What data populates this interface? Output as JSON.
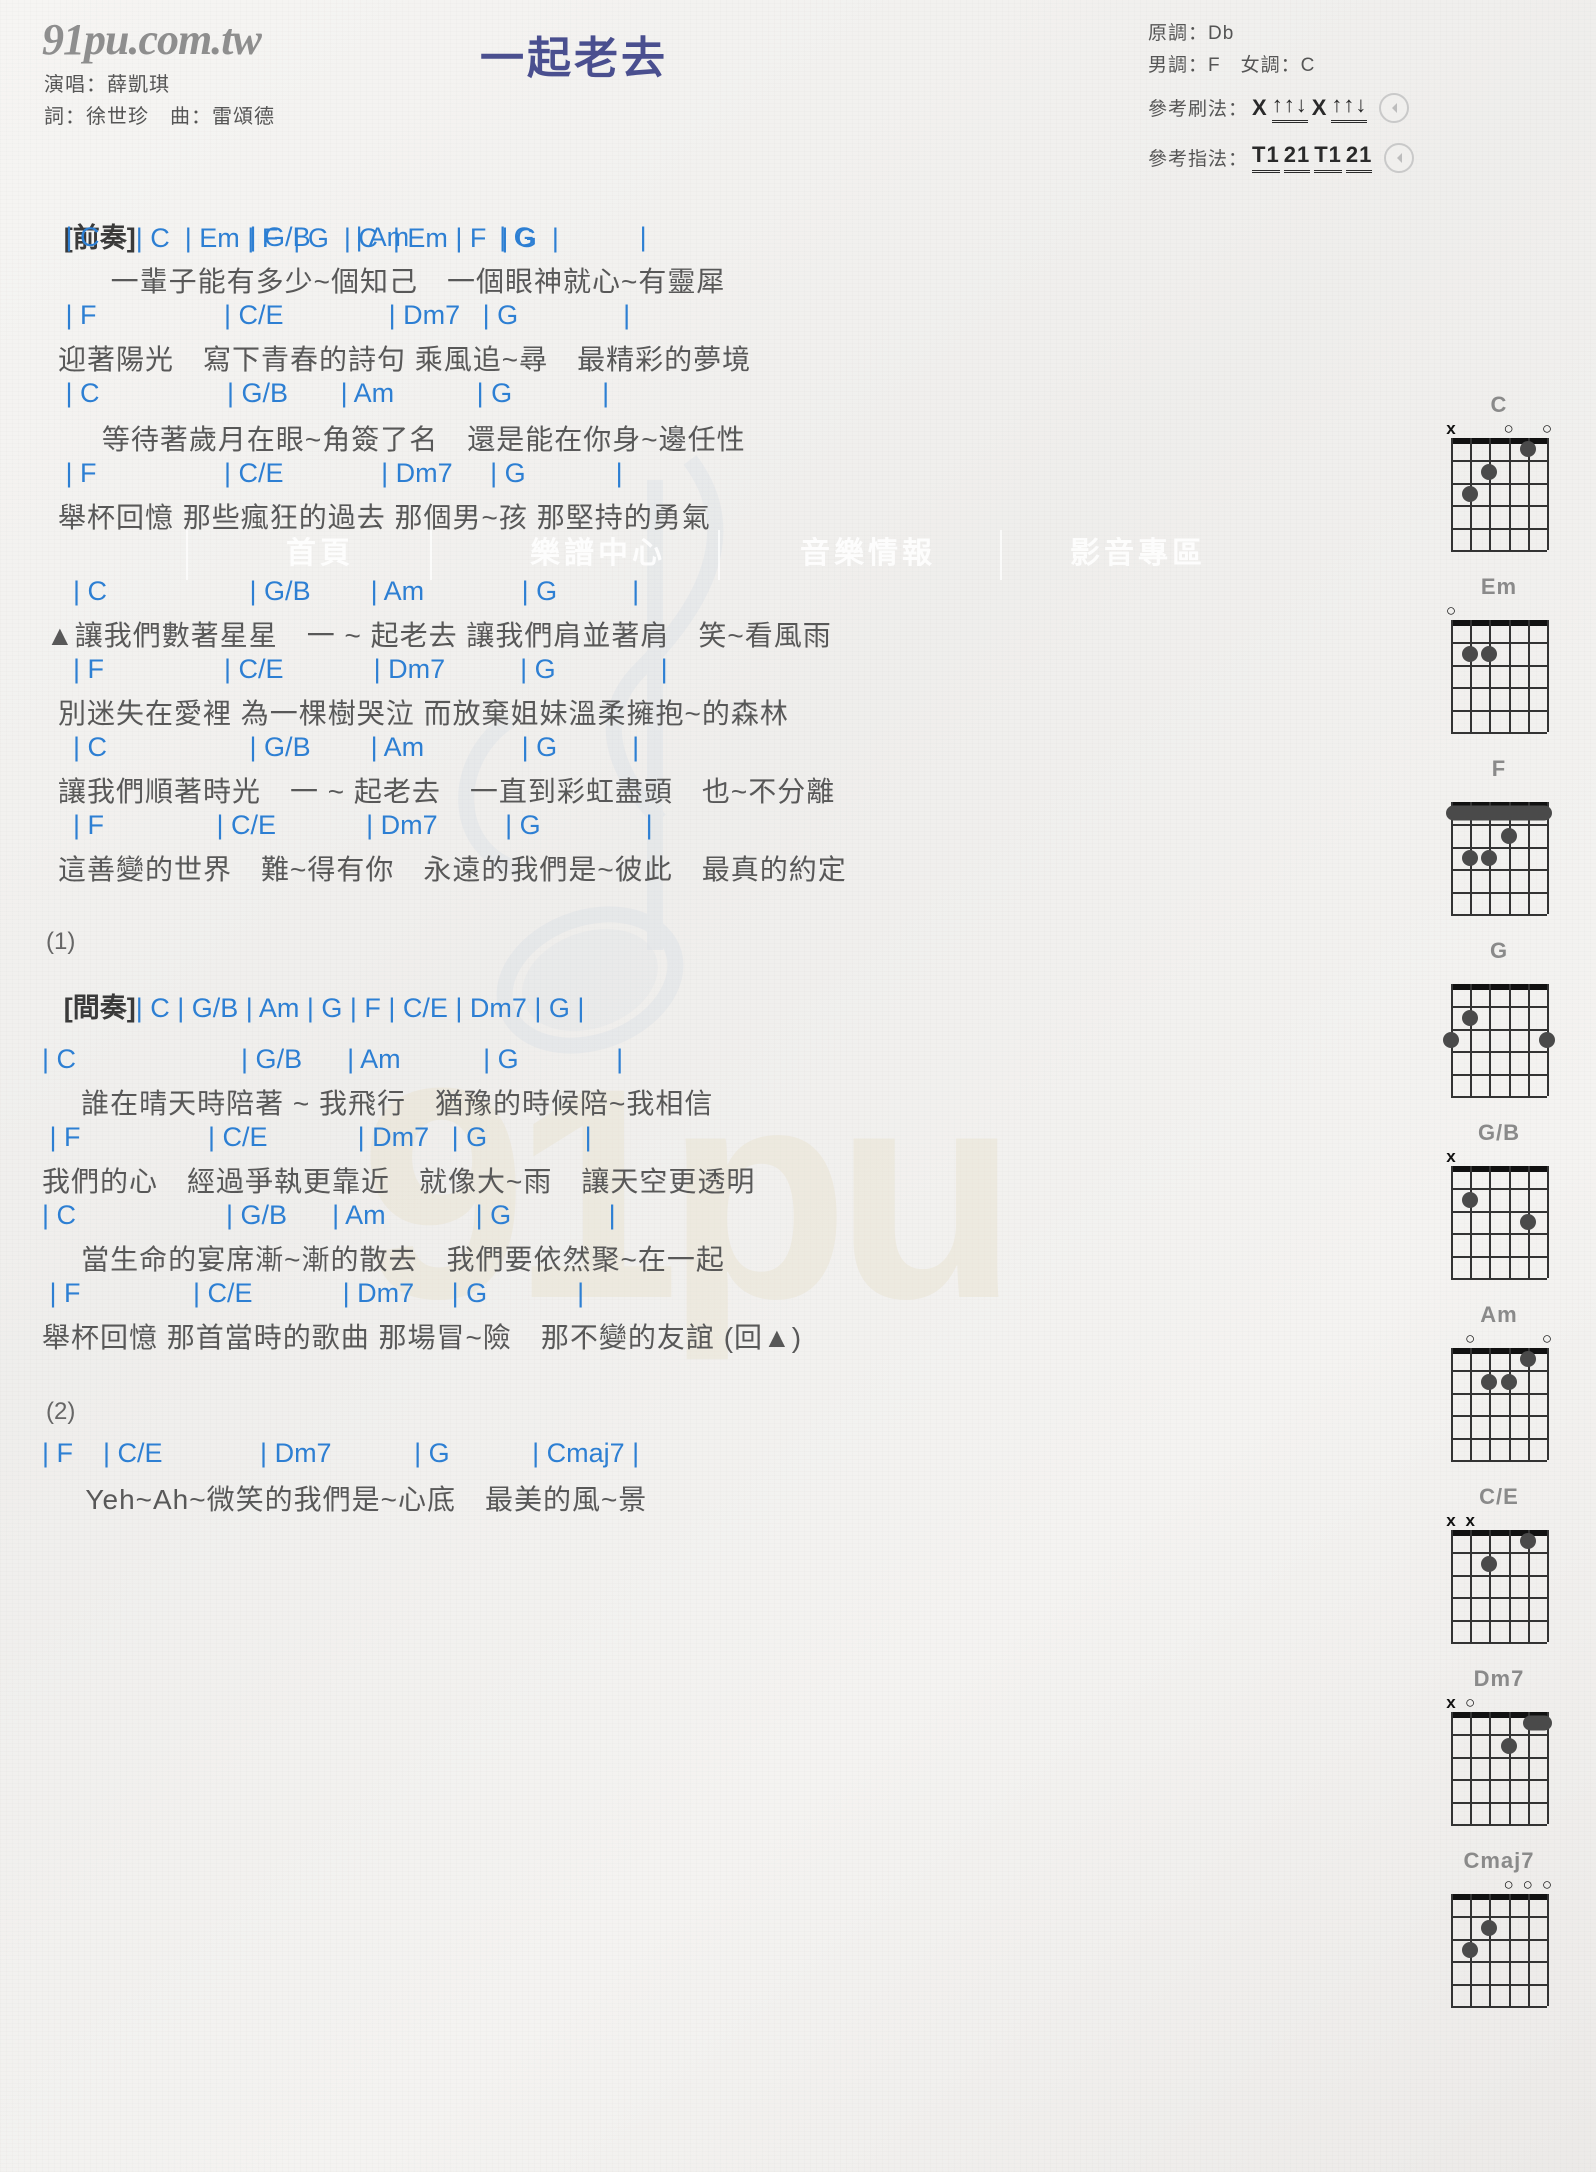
{
  "site": {
    "logo": "91pu.com.tw"
  },
  "header": {
    "title": "一起老去",
    "singer_label": "演唱：薛凱琪",
    "writers_label": "詞：徐世珍　曲：雷頌德",
    "key_original": "原調：Db",
    "key_male_female": "男調：F　女調：C",
    "strum_label": "參考刷法：",
    "strum_pattern_1": "X",
    "strum_pattern_2": "↑↑↓",
    "strum_pattern_3": "X",
    "strum_pattern_4": "↑↑↓",
    "finger_label": "參考指法：",
    "finger_pattern_1": "T1",
    "finger_pattern_2": "21",
    "finger_pattern_3": "T1",
    "finger_pattern_4": "21"
  },
  "watermark": {
    "big_text": "91pu",
    "nav_home": "首頁",
    "nav_scores": "樂譜中心",
    "nav_music_info": "音樂情報",
    "nav_av": "影音專區"
  },
  "intro": {
    "tag": "[前奏]",
    "chords": "| C  | Em | F  | G  | C  | Em | F  | G  |"
  },
  "interlude": {
    "tag": "[間奏]",
    "chords": "| C | G/B | Am | G | F | C/E | Dm7 | G |"
  },
  "repeat_marks": {
    "one": "(1)",
    "two": "(2)"
  },
  "sections": [
    {
      "name": "verse-1",
      "lines": [
        {
          "chords": " | C                    | G/B      | Am            | G              |",
          "lyrics": "      一輩子能有多少~個知己　一個眼神就心~有靈犀"
        },
        {
          "chords": " | F                 | C/E              | Dm7   | G              |",
          "lyrics": "迎著陽光　寫下青春的詩句 乘風追~尋　最精彩的夢境"
        },
        {
          "chords": " | C                 | G/B       | Am           | G            |",
          "lyrics": "     等待著歲月在眼~角簽了名　還是能在你身~邊任性"
        },
        {
          "chords": " | F                 | C/E             | Dm7     | G            |",
          "lyrics": "舉杯回憶 那些瘋狂的過去 那個男~孩 那堅持的勇氣"
        }
      ]
    },
    {
      "name": "chorus",
      "lines": [
        {
          "chords": "  | C                   | G/B        | Am             | G          |",
          "lyrics": "▲讓我們數著星星　一 ~ 起老去 讓我們肩並著肩　笑~看風雨"
        },
        {
          "chords": "  | F                | C/E            | Dm7          | G              |",
          "lyrics": "別迷失在愛裡 為一棵樹哭泣 而放棄姐妹溫柔擁抱~的森林"
        },
        {
          "chords": "  | C                   | G/B        | Am             | G          |",
          "lyrics": "讓我們順著時光　一 ~ 起老去　一直到彩虹盡頭　也~不分離"
        },
        {
          "chords": "  | F               | C/E            | Dm7         | G              |",
          "lyrics": "這善變的世界　難~得有你　永遠的我們是~彼此　最真的約定"
        }
      ]
    },
    {
      "name": "verse-2",
      "lines": [
        {
          "chords": "| C                      | G/B      | Am           | G             |",
          "lyrics": "    誰在晴天時陪著 ~ 我飛行　猶豫的時候陪~我相信"
        },
        {
          "chords": " | F                 | C/E            | Dm7   | G             |",
          "lyrics": "我們的心　經過爭執更靠近　就像大~雨　讓天空更透明"
        },
        {
          "chords": "| C                    | G/B      | Am            | G             |",
          "lyrics": "    當生命的宴席漸~漸的散去　我們要依然聚~在一起"
        },
        {
          "chords": " | F               | C/E            | Dm7     | G            |",
          "lyrics": "舉杯回憶 那首當時的歌曲 那場冒~險　那不變的友誼 (回▲)"
        }
      ]
    },
    {
      "name": "outro",
      "lines": [
        {
          "chords": "| F    | C/E             | Dm7           | G           | Cmaj7 |",
          "lyrics": "     Yeh~Ah~微笑的我們是~心底　最美的風~景"
        }
      ]
    }
  ],
  "chord_diagrams": [
    {
      "name": "C",
      "marks": [
        {
          "t": "x",
          "s": 6
        },
        {
          "t": "o",
          "s": 3
        },
        {
          "t": "o",
          "s": 1
        }
      ],
      "dots": [
        {
          "s": 5,
          "f": 3
        },
        {
          "s": 4,
          "f": 2
        },
        {
          "s": 2,
          "f": 1
        }
      ],
      "barre": null
    },
    {
      "name": "Em",
      "marks": [
        {
          "t": "o",
          "s": 6
        }
      ],
      "dots": [
        {
          "s": 5,
          "f": 2
        },
        {
          "s": 4,
          "f": 2
        }
      ],
      "barre": null
    },
    {
      "name": "F",
      "marks": [],
      "dots": [
        {
          "s": 3,
          "f": 2
        },
        {
          "s": 5,
          "f": 3
        },
        {
          "s": 4,
          "f": 3
        }
      ],
      "barre": {
        "f": 1,
        "from": 6,
        "to": 1
      }
    },
    {
      "name": "G",
      "marks": [],
      "dots": [
        {
          "s": 5,
          "f": 2
        },
        {
          "s": 6,
          "f": 3
        },
        {
          "s": 1,
          "f": 3
        }
      ],
      "barre": null
    },
    {
      "name": "G/B",
      "marks": [
        {
          "t": "x",
          "s": 6
        }
      ],
      "dots": [
        {
          "s": 5,
          "f": 2
        },
        {
          "s": 2,
          "f": 3
        }
      ],
      "barre": null
    },
    {
      "name": "Am",
      "marks": [
        {
          "t": "o",
          "s": 5
        },
        {
          "t": "o",
          "s": 1
        }
      ],
      "dots": [
        {
          "s": 2,
          "f": 1
        },
        {
          "s": 4,
          "f": 2
        },
        {
          "s": 3,
          "f": 2
        }
      ],
      "barre": null
    },
    {
      "name": "C/E",
      "marks": [
        {
          "t": "x",
          "s": 6
        },
        {
          "t": "x",
          "s": 5
        }
      ],
      "dots": [
        {
          "s": 2,
          "f": 1
        },
        {
          "s": 4,
          "f": 2
        }
      ],
      "barre": null
    },
    {
      "name": "Dm7",
      "marks": [
        {
          "t": "x",
          "s": 6
        },
        {
          "t": "o",
          "s": 5
        }
      ],
      "dots": [
        {
          "s": 3,
          "f": 2
        }
      ],
      "barre": {
        "f": 1,
        "from": 2,
        "to": 1
      }
    },
    {
      "name": "Cmaj7",
      "marks": [
        {
          "t": "o",
          "s": 3
        },
        {
          "t": "o",
          "s": 2
        },
        {
          "t": "o",
          "s": 1
        }
      ],
      "dots": [
        {
          "s": 4,
          "f": 2
        },
        {
          "s": 5,
          "f": 3
        }
      ],
      "barre": null
    }
  ]
}
